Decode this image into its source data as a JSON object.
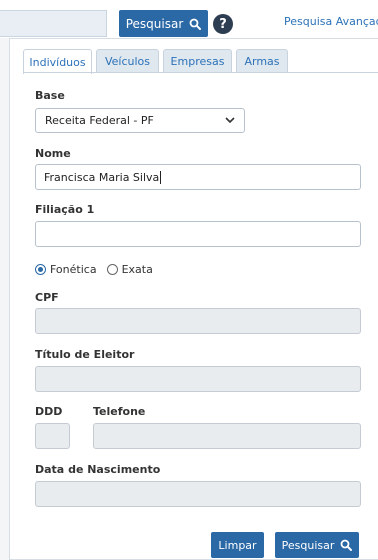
{
  "topbar": {
    "search_button_label": "Pesquisar",
    "help_icon": "?",
    "advanced_search_link": "Pesquisa Avançada"
  },
  "tabs": [
    {
      "label": "Indivíduos",
      "active": true
    },
    {
      "label": "Veículos",
      "active": false
    },
    {
      "label": "Empresas",
      "active": false
    },
    {
      "label": "Armas",
      "active": false
    }
  ],
  "form": {
    "base_label": "Base",
    "base_value": "Receita Federal - PF",
    "nome_label": "Nome",
    "nome_value": "Francisca Maria Silva",
    "filiacao_label": "Filiação 1",
    "filiacao_value": "",
    "radio_fonetica": "Fonética",
    "radio_exata": "Exata",
    "radio_selected": "Fonética",
    "cpf_label": "CPF",
    "titulo_label": "Título de Eleitor",
    "ddd_label": "DDD",
    "telefone_label": "Telefone",
    "nascimento_label": "Data de Nascimento"
  },
  "actions": {
    "clear_label": "Limpar",
    "search_label": "Pesquisar"
  },
  "colors": {
    "primary": "#2a68a6",
    "link": "#2c72b8",
    "disabled_field": "#e9ecef"
  }
}
